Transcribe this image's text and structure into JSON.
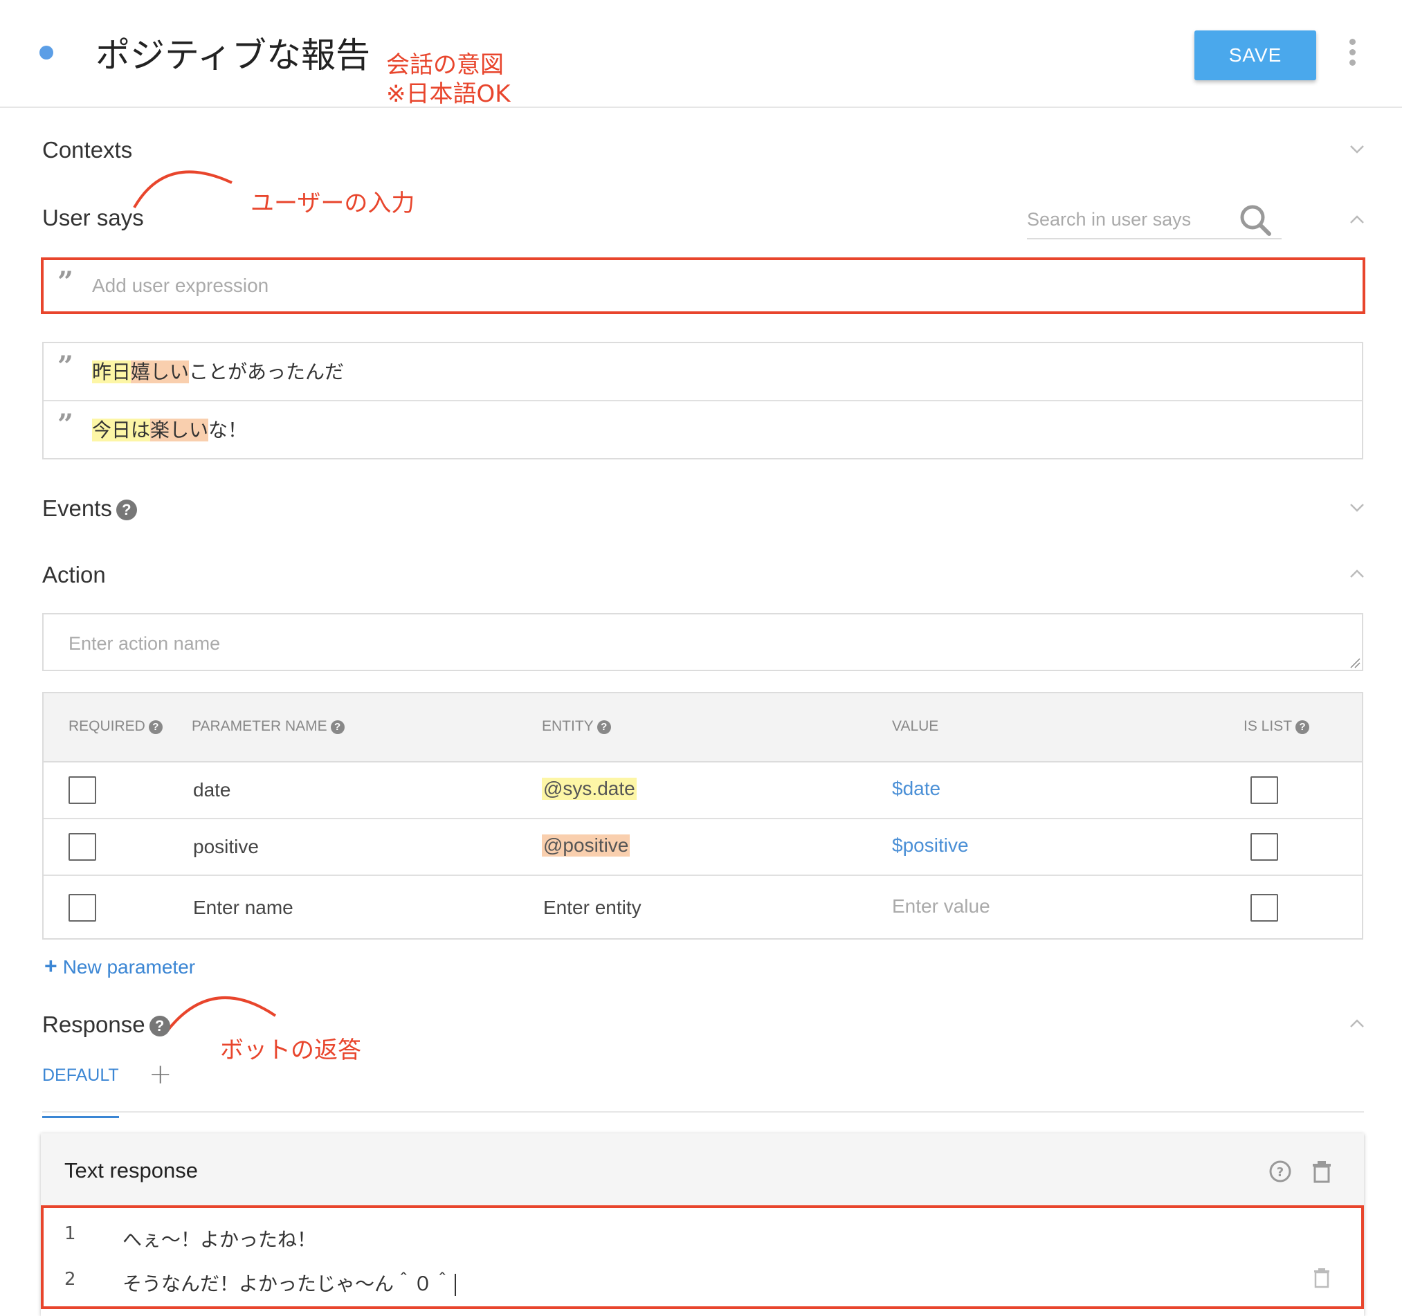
{
  "header": {
    "title": "ポジティブな報告",
    "save_label": "SAVE"
  },
  "annotations": {
    "intent": "会話の意図",
    "japanese_ok": "※日本語OK",
    "user_input": "ユーザーの入力",
    "bot_response": "ボットの返答"
  },
  "contexts": {
    "title": "Contexts"
  },
  "user_says": {
    "title": "User says",
    "search_placeholder": "Search in user says",
    "add_placeholder": "Add user expression",
    "expressions": [
      {
        "parts": [
          "昨日",
          "嬉しい",
          "ことがあったんだ"
        ]
      },
      {
        "parts": [
          "今日は",
          "楽しい",
          "な！"
        ]
      }
    ]
  },
  "events": {
    "title": "Events"
  },
  "action": {
    "title": "Action",
    "placeholder": "Enter action name",
    "columns": {
      "required": "REQUIRED",
      "parameter_name": "PARAMETER NAME",
      "entity": "ENTITY",
      "value": "VALUE",
      "is_list": "IS LIST"
    },
    "rows": [
      {
        "name": "date",
        "entity": "@sys.date",
        "value": "$date"
      },
      {
        "name": "positive",
        "entity": "@positive",
        "value": "$positive"
      }
    ],
    "empty_row": {
      "name": "Enter name",
      "entity": "Enter entity",
      "value": "Enter value"
    },
    "new_parameter": "New parameter"
  },
  "response": {
    "title": "Response",
    "tab_default": "DEFAULT",
    "text_response_title": "Text response",
    "lines": [
      {
        "num": "1",
        "text": "へぇ〜！よかったね！"
      },
      {
        "num": "2",
        "text": "そうなんだ！よかったじゃ〜ん＾０＾"
      }
    ]
  },
  "colors": {
    "accent": "#4aa8ec",
    "annotation": "#e8452c",
    "highlight_yellow": "#fdf6a6",
    "highlight_orange": "#f9cfae",
    "link": "#3b86d4"
  },
  "icons": [
    "status-dot",
    "more-vert-icon",
    "chevron-down-icon",
    "chevron-up-icon",
    "search-icon",
    "quote-icon",
    "help-icon",
    "plus-icon",
    "trash-icon"
  ]
}
